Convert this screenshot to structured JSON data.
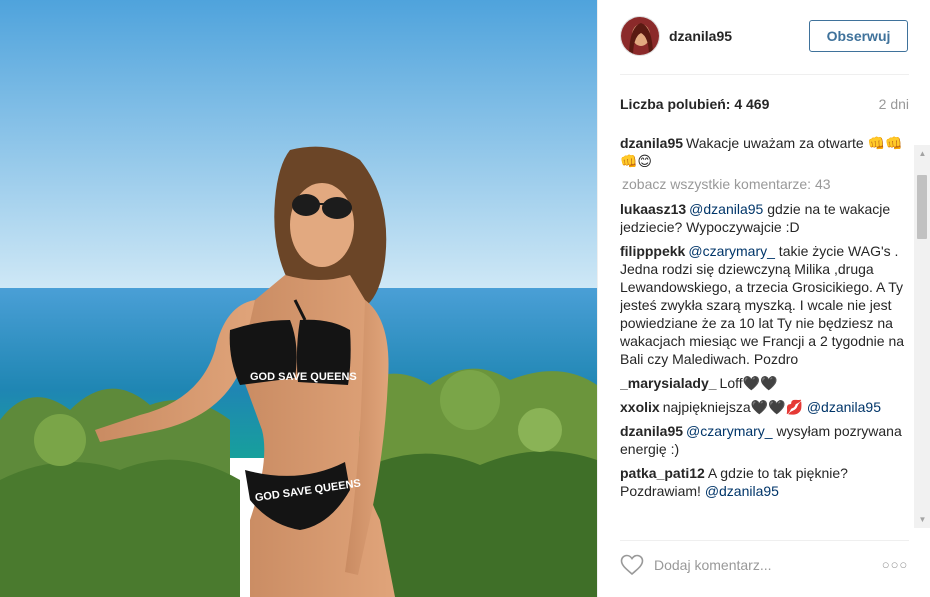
{
  "post": {
    "username": "dzanila95",
    "follow_label": "Obserwuj",
    "likes_text": "Liczba polubień: 4 469",
    "time_ago": "2 dni",
    "view_all_comments": "zobacz wszystkie komentarze: 43"
  },
  "caption": {
    "author": "dzanila95",
    "text": "Wakacje uważam za otwarte 👊👊👊😊"
  },
  "comments": [
    {
      "author": "lukaasz13",
      "parts": [
        {
          "mention": "@dzanila95"
        },
        {
          "text": " gdzie na te wakacje jedziecie? Wypoczywajcie :D"
        }
      ]
    },
    {
      "author": "filipppekk",
      "parts": [
        {
          "mention": "@czarymary_"
        },
        {
          "text": " takie życie WAG's . Jedna rodzi się dziewczyną Milika ,druga Lewandowskiego, a trzecia Grosicikiego. A Ty jesteś zwykła szarą myszką. I wcale nie jest powiedziane że za 10 lat Ty nie będziesz na wakacjach miesiąc we Francji a 2 tygodnie na Bali czy Malediwach. Pozdro"
        }
      ]
    },
    {
      "author": "_marysialady_",
      "parts": [
        {
          "text": "Loff🖤🖤"
        }
      ]
    },
    {
      "author": "xxolix",
      "parts": [
        {
          "text": "najpiękniejsza🖤🖤💋 "
        },
        {
          "mention": "@dzanila95"
        }
      ]
    },
    {
      "author": "dzanila95",
      "parts": [
        {
          "mention": "@czarymary_"
        },
        {
          "text": " wysyłam pozrywana energię :)"
        }
      ]
    },
    {
      "author": "patka_pati12",
      "parts": [
        {
          "text": "A gdzie to tak pięknie? Pozdrawiam! "
        },
        {
          "mention": "@dzanila95"
        }
      ]
    }
  ],
  "footer": {
    "comment_placeholder": "Dodaj komentarz...",
    "more_label": "○○○"
  },
  "photo": {
    "text_on_top": "GOD SAVE QUEENS",
    "text_on_bottom": "GOD SAVE QUEENS"
  },
  "scrollbar": {
    "up_arrow": "▲",
    "down_arrow": "▼"
  },
  "colors": {
    "follow": "#3f729b",
    "mention": "#003569",
    "muted": "#999999"
  }
}
